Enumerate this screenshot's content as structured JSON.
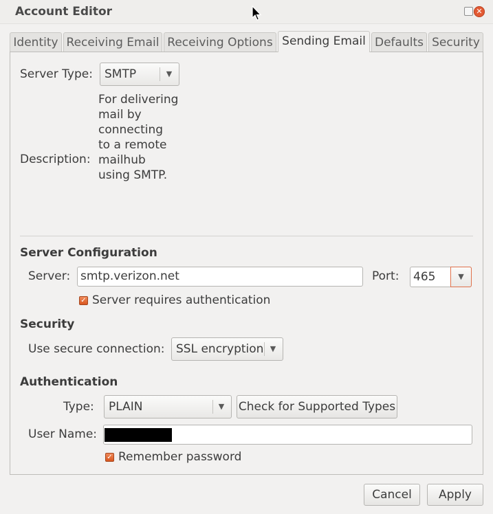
{
  "window": {
    "title": "Account Editor"
  },
  "tabs": [
    {
      "label": "Identity",
      "active": false
    },
    {
      "label": "Receiving Email",
      "active": false
    },
    {
      "label": "Receiving Options",
      "active": false
    },
    {
      "label": "Sending Email",
      "active": true
    },
    {
      "label": "Defaults",
      "active": false
    },
    {
      "label": "Security",
      "active": false
    }
  ],
  "server_type": {
    "label": "Server Type:",
    "value": "SMTP",
    "description_label": "Description:",
    "description_lines": [
      "For delivering",
      "mail by",
      "connecting",
      "to a remote",
      "mailhub",
      "using SMTP."
    ]
  },
  "server_configuration": {
    "heading": "Server Configuration",
    "server_label": "Server:",
    "server_value": "smtp.verizon.net",
    "port_label": "Port:",
    "port_value": "465",
    "requires_auth_label": "Server requires authentication",
    "requires_auth_checked": true
  },
  "security": {
    "heading": "Security",
    "secure_connection_label": "Use secure connection:",
    "secure_connection_value": "SSL encryption"
  },
  "authentication": {
    "heading": "Authentication",
    "type_label": "Type:",
    "type_value": "PLAIN",
    "check_types_button": "Check for Supported Types",
    "username_label": "User Name:",
    "remember_password_label": "Remember password",
    "remember_password_checked": true
  },
  "footer": {
    "cancel_label": "Cancel",
    "apply_label": "Apply"
  },
  "icons": {
    "close": "close-icon",
    "restore": "restore-icon",
    "dropdown": "chevron-down-icon",
    "check": "checkmark-icon"
  },
  "colors": {
    "accent": "#e35a33",
    "checkbox": "#dd6128"
  }
}
